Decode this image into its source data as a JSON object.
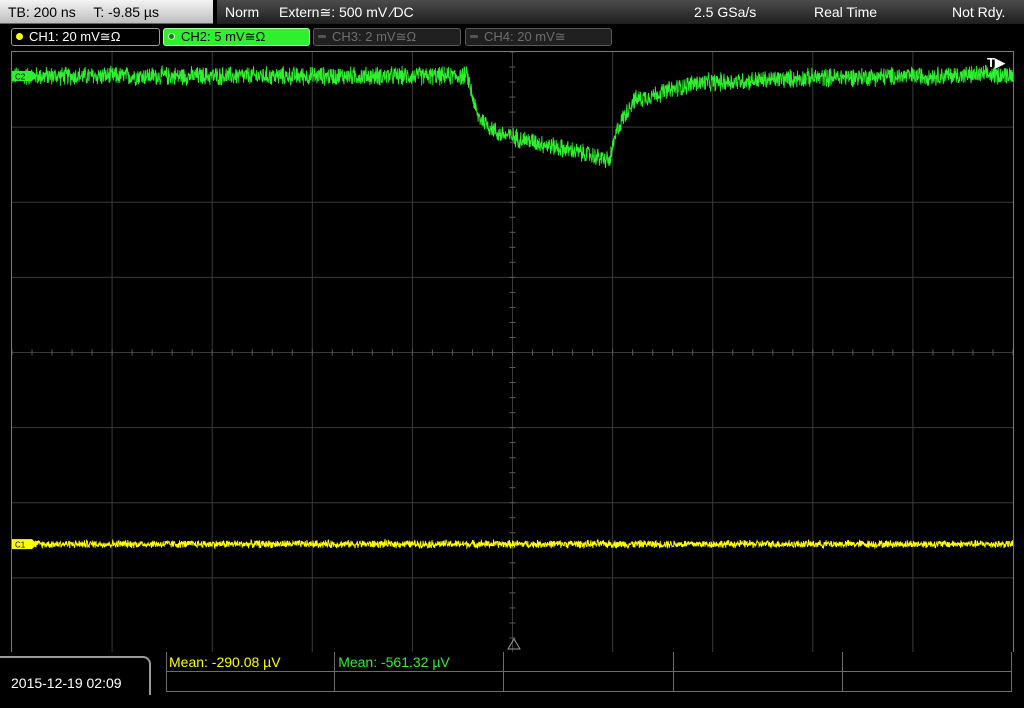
{
  "status_bar": {
    "timebase": "TB: 200 ns",
    "trigger_time": "T: -9.85 µs",
    "mode": "Norm",
    "trigger_source": "Extern≅: 500 mV ∕DC",
    "sample_rate": "2.5 GSa/s",
    "acquisition": "Real Time",
    "status": "Not Rdy."
  },
  "channels": [
    {
      "label": "CH1: 20 mV≅Ω",
      "color": "#ffff00",
      "state": "on"
    },
    {
      "label": "CH2: 5 mV≅Ω",
      "color": "#2df12d",
      "state": "selected"
    },
    {
      "label": "CH3: 2 mV≅Ω",
      "color": "#6d6d6d",
      "state": "off"
    },
    {
      "label": "CH4: 20 mV≅",
      "color": "#6d6d6d",
      "state": "off"
    }
  ],
  "screen": {
    "trigger_marker": "T▶",
    "ch2_marker": "C2",
    "ch1_marker": "C1"
  },
  "chart_data": {
    "type": "line",
    "grid": {
      "divisions_x": 10,
      "divisions_y": 8,
      "on": true
    },
    "series": [
      {
        "channel": "CH2",
        "color": "#2df12d",
        "noise_div": 0.12,
        "profile_div": [
          [
            0.0,
            7.68
          ],
          [
            4.55,
            7.68
          ],
          [
            4.65,
            7.15
          ],
          [
            4.85,
            6.92
          ],
          [
            5.8,
            6.62
          ],
          [
            5.97,
            6.55
          ],
          [
            6.05,
            6.98
          ],
          [
            6.2,
            7.35
          ],
          [
            6.8,
            7.58
          ],
          [
            8.0,
            7.66
          ],
          [
            10.0,
            7.7
          ]
        ]
      },
      {
        "channel": "CH1",
        "color": "#ffff00",
        "noise_div": 0.05,
        "profile_div": [
          [
            0.0,
            1.45
          ],
          [
            10.0,
            1.45
          ]
        ]
      }
    ]
  },
  "bottom": {
    "datetime": "2015-12-19 02:09",
    "measurements": [
      {
        "text": "Mean: -290.08 µV",
        "color": "#ffff00"
      },
      {
        "text": "Mean: -561.32 µV",
        "color": "#2df12d"
      },
      {
        "text": ""
      },
      {
        "text": ""
      },
      {
        "text": ""
      },
      {
        "text": ""
      },
      {
        "text": ""
      },
      {
        "text": ""
      },
      {
        "text": ""
      },
      {
        "text": ""
      }
    ]
  }
}
